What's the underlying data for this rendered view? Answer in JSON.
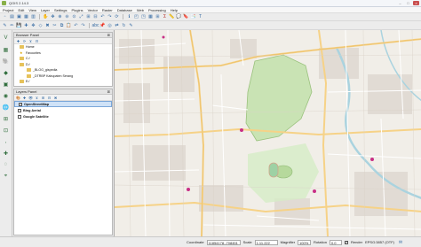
{
  "window": {
    "title": "QGIS 2.14.3",
    "controls": [
      "–",
      "□",
      "×"
    ]
  },
  "menu": [
    "Project",
    "Edit",
    "View",
    "Layer",
    "Settings",
    "Plugins",
    "Vector",
    "Raster",
    "Database",
    "Web",
    "Processing",
    "Help"
  ],
  "browser_panel": {
    "title": "Browser Panel",
    "items": [
      {
        "label": "Home",
        "icon": "folder-icon"
      },
      {
        "label": "Favourites",
        "icon": "star-icon"
      },
      {
        "label": "C:/",
        "icon": "drive-icon"
      },
      {
        "label": "D:/",
        "icon": "drive-icon"
      },
      {
        "label": "_BLOG_gispedia",
        "icon": "folder-icon"
      },
      {
        "label": "_DTRBP Kabupaten Serang",
        "icon": "folder-icon"
      },
      {
        "label": "E:/",
        "icon": "drive-icon"
      },
      {
        "label": "F:/",
        "icon": "drive-icon"
      }
    ]
  },
  "layers_panel": {
    "title": "Layers Panel",
    "layers": [
      {
        "label": "OpenStreetMap",
        "checked": true,
        "selected": true
      },
      {
        "label": "Bing Aerial",
        "checked": false,
        "selected": false
      },
      {
        "label": "Google Satellite",
        "checked": false,
        "selected": false
      }
    ]
  },
  "statusbar": {
    "coordinate_label": "Coordinate",
    "coordinate_value": "11854178,-708451",
    "scale_label": "Scale",
    "scale_value": "1:11,222",
    "magnifier_label": "Magnifier",
    "magnifier_value": "100%",
    "rotation_label": "Rotation",
    "rotation_value": "0.0",
    "render_label": "Render",
    "render_checked": true,
    "crs_label": "EPSG:3857 (OTF)"
  },
  "colors": {
    "park": "#c9e3b4",
    "water": "#aad3df",
    "road_major": "#f6d287",
    "road_minor": "#ffffff",
    "building": "#d9d0c9",
    "poi": "#c82f86"
  }
}
